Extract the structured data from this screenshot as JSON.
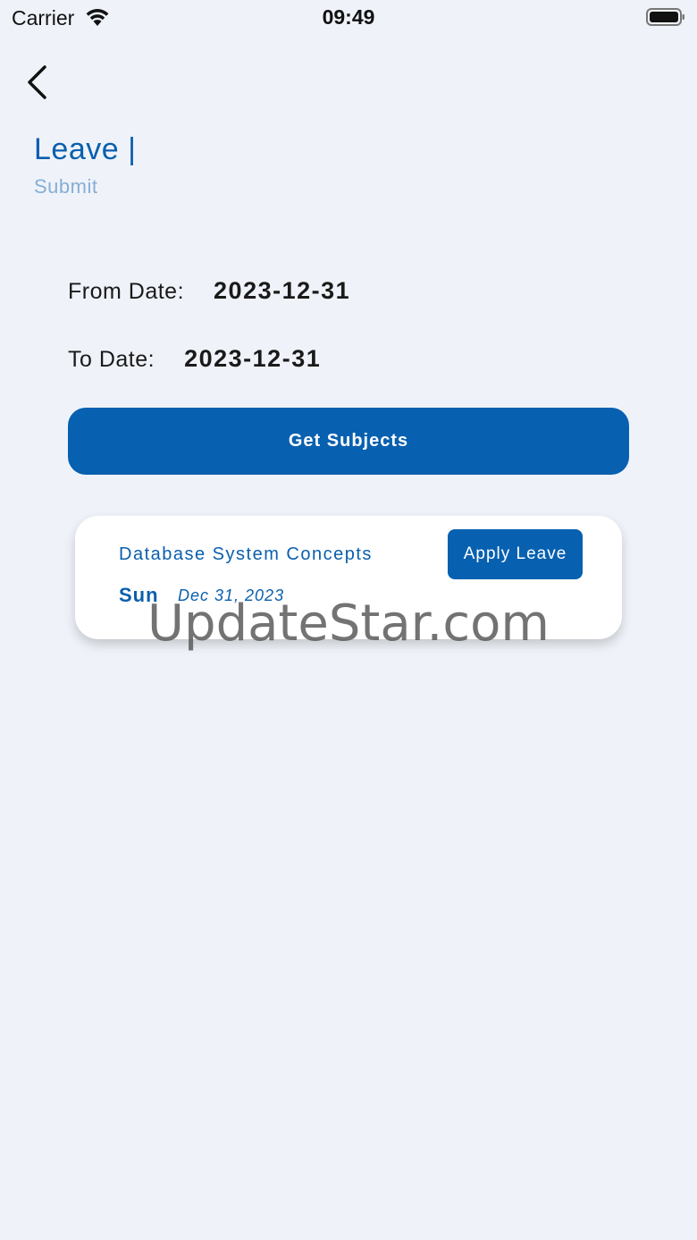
{
  "status_bar": {
    "carrier": "Carrier",
    "time": "09:49",
    "wifi_icon": "wifi-icon",
    "battery_icon": "battery-icon"
  },
  "navigation": {
    "back_icon": "chevron-left-icon"
  },
  "header": {
    "title": "Leave |",
    "subtitle": "Submit"
  },
  "filters": {
    "from_label": "From Date:",
    "from_value": "2023-12-31",
    "to_label": "To Date:",
    "to_value": "2023-12-31"
  },
  "actions": {
    "get_subjects_label": "Get Subjects"
  },
  "subjects": [
    {
      "name": "Database System Concepts",
      "day": "Sun",
      "date": "Dec 31, 2023",
      "apply_label": "Apply Leave"
    }
  ],
  "watermark": "UpdateStar.com",
  "colors": {
    "primary": "#0760b0",
    "background": "#eff3f9",
    "subtitle": "#86aed6"
  }
}
